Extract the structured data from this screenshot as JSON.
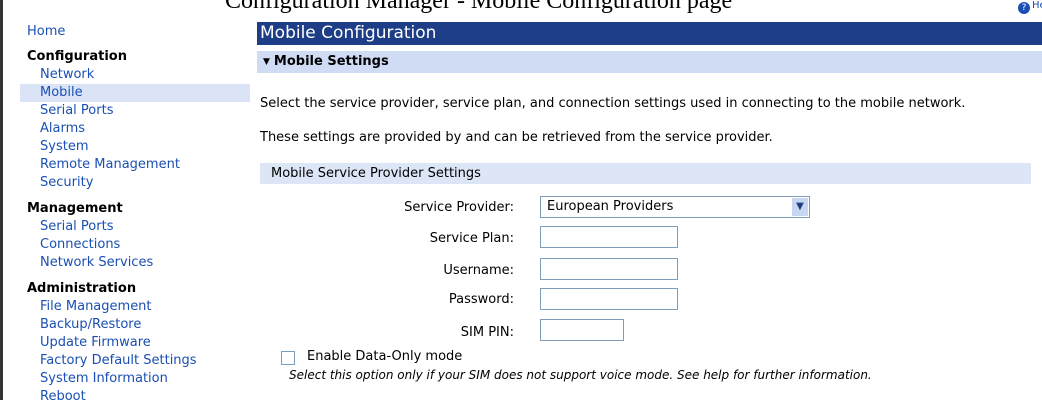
{
  "header": {
    "clipped_text": "Configuration Manager - Mobile Configuration page",
    "help_icon": "help-icon",
    "help_text": "He"
  },
  "sidebar": {
    "home": "Home",
    "sections": [
      {
        "title": "Configuration",
        "items": [
          "Network",
          "Mobile",
          "Serial Ports",
          "Alarms",
          "System",
          "Remote Management",
          "Security"
        ]
      },
      {
        "title": "Management",
        "items": [
          "Serial Ports",
          "Connections",
          "Network Services"
        ]
      },
      {
        "title": "Administration",
        "items": [
          "File Management",
          "Backup/Restore",
          "Update Firmware",
          "Factory Default Settings",
          "System Information",
          "Reboot"
        ]
      }
    ],
    "active_item": "Mobile"
  },
  "main": {
    "title": "Mobile Configuration",
    "section_title": "Mobile Settings",
    "para1": "Select the service provider, service plan, and connection settings used in connecting to the mobile network.",
    "para2": "These settings are provided by and can be retrieved from the service provider.",
    "subsection_title": "Mobile Service Provider Settings",
    "form": {
      "provider_label": "Service Provider:",
      "provider_value": "European Providers",
      "plan_label": "Service Plan:",
      "plan_value": "",
      "username_label": "Username:",
      "username_value": "",
      "password_label": "Password:",
      "password_value": "",
      "simpin_label": "SIM PIN:",
      "simpin_value": ""
    },
    "data_only_label": "Enable Data-Only mode",
    "data_only_checked": false,
    "data_only_note": "Select this option only if your SIM does not support voice mode. See help for further information."
  },
  "colors": {
    "title_bar": "#1d3e86",
    "section_bar": "#cfdcf4",
    "link": "#1a4fb3",
    "active_bg": "#dbe4f7"
  }
}
